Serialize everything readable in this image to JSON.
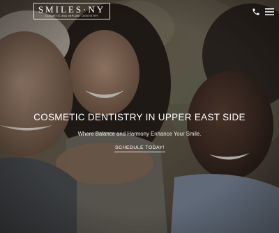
{
  "header": {
    "logo_main": "SMILES·NY",
    "logo_sub": "COSMETIC AND IMPLANT DENTISTRY"
  },
  "hero": {
    "headline": "COSMETIC DENTISTRY IN UPPER EAST SIDE",
    "tagline": "Where Balance and Harmony Enhance Your Smile.",
    "cta_label": "SCHEDULE TODAY!"
  },
  "colors": {
    "text": "#ffffff",
    "overlay": "#141210"
  }
}
